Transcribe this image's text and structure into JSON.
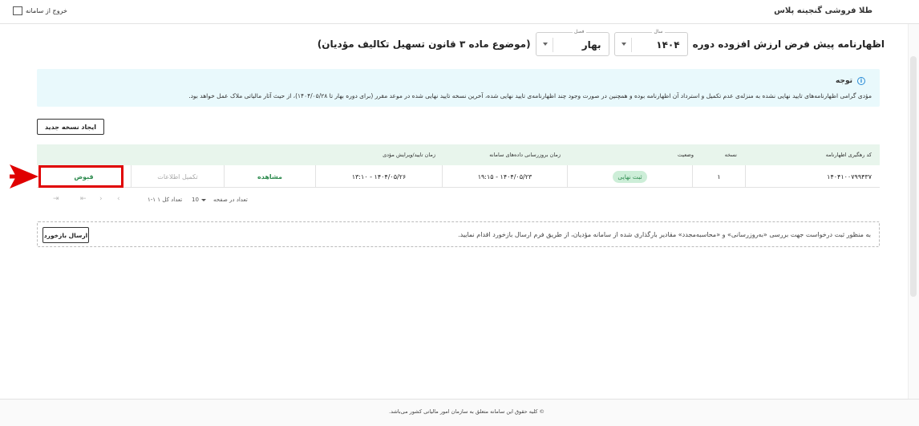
{
  "header": {
    "brand": "طلا فروشی گنجینه پلاس",
    "logout_label": "خروج از سامانه"
  },
  "title": {
    "text": "اظهارنامه پیش فرض ارزش افزوده دوره",
    "year_label": "سال",
    "year_value": "۱۴۰۴",
    "season_label": "فصل",
    "season_value": "بهار",
    "suffix": "(موضوع ماده ۳ قانون تسهیل تکالیف مؤدیان)"
  },
  "notice": {
    "title": "توجه",
    "body": "مؤدی گرامی اظهارنامه‌های تایید نهایی نشده به منزله‌ی عدم تکمیل و استرداد آن اظهارنامه بوده و همچنین در صورت وجود چند اظهارنامه‌ی تایید نهایی شده، آخرین نسخه تایید نهایی شده در موعد مقرر (برای دوره بهار تا ۱۴۰۴/۰۵/۲۸)، از حیث آثار مالیاتی ملاک عمل خواهد بود."
  },
  "new_button": "ایجاد نسخه جدید",
  "table": {
    "headers": {
      "tracking": "کد رهگیری اظهارنامه",
      "version": "نسخه",
      "status": "وضعیت",
      "update_time": "زمان بروزرسانی داده‌های سامانه",
      "approve_time": "زمان تایید/ویرایش مؤدی"
    },
    "rows": [
      {
        "tracking": "۱۴۰۴۱۰۰۷۹۹۴۳۷",
        "version": "۱",
        "status": "ثبت نهایی",
        "update_time": "۱۹:۱۵ - ۱۴۰۴/۰۵/۲۳",
        "approve_time": "۱۳:۱۰ - ۱۴۰۴/۰۵/۲۶",
        "view": "مشاهده",
        "complete": "تکمیل اطلاعات",
        "receipt": "قبوض"
      }
    ],
    "pager": {
      "per_page_label": "تعداد در صفحه",
      "per_page": "10",
      "count": "۱-۱ تعداد کل ۱"
    }
  },
  "callout": {
    "text": "به منظور ثبت درخواست جهت بررسی «به‌روزرسانی» و «محاسبه‌مجدد» مقادیر بارگذاری شده از سامانه مؤدیان، از طریق فرم ارسال بازخورد اقدام نمایید.",
    "button": "ارسال بازخورد"
  },
  "footer": "© کلیه حقوق این سامانه متعلق به سازمان امور مالیاتی کشور می‌باشد.",
  "colors": {
    "accent_green": "#2e8b4f",
    "highlight_red": "#e00000",
    "notice_bg": "#e9f9fc"
  }
}
